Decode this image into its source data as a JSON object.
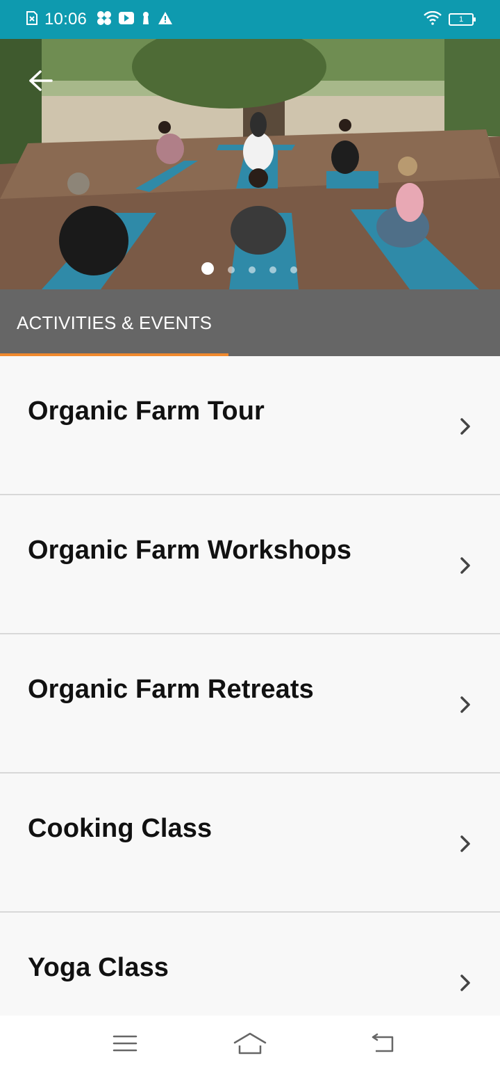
{
  "status_bar": {
    "time": "10:06",
    "battery_level": "1",
    "icons": [
      "sim-error-icon",
      "pinwheel-icon",
      "youtube-icon",
      "keyhole-icon",
      "warning-icon",
      "wifi-icon",
      "battery-icon"
    ]
  },
  "hero": {
    "back_icon": "arrow-left-icon",
    "carousel_pages": 5,
    "carousel_active_index": 0
  },
  "tabs": [
    {
      "label": "ACTIVITIES & EVENTS",
      "active": true
    }
  ],
  "list": {
    "items": [
      {
        "label": "Organic Farm Tour"
      },
      {
        "label": "Organic Farm Workshops"
      },
      {
        "label": "Organic Farm Retreats"
      },
      {
        "label": "Cooking Class"
      },
      {
        "label": "Yoga Class"
      }
    ],
    "chevron_icon": "chevron-right-icon"
  },
  "nav_bar": {
    "icons": [
      "menu-icon",
      "home-icon",
      "back-icon"
    ]
  },
  "colors": {
    "status_bar": "#0e9aaf",
    "tab_bar": "#666666",
    "tab_indicator": "#f0892e",
    "list_bg": "#f8f8f8",
    "text": "#111111"
  }
}
